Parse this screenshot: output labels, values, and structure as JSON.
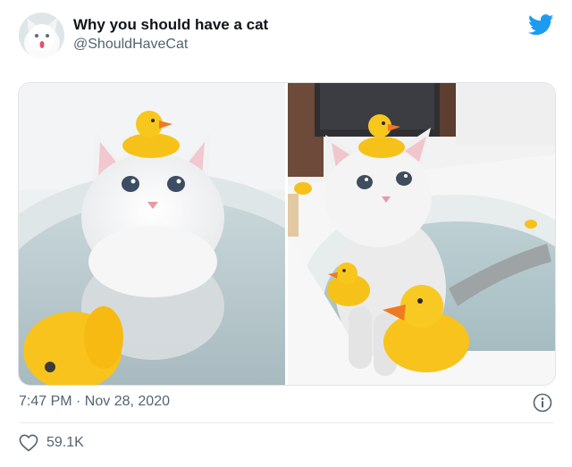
{
  "tweet": {
    "author": {
      "display_name": "Why you should have a cat",
      "handle": "@ShouldHaveCat",
      "avatar_icon": "white-cat-avatar"
    },
    "brand_icon": "twitter-bird-icon",
    "media": {
      "photo_count": 2
    },
    "timestamp": "7:47 PM · Nov 28, 2020",
    "info_icon": "info-icon",
    "likes": {
      "icon": "heart-icon",
      "count": "59.1K"
    }
  },
  "colors": {
    "twitter_blue": "#1d9bf0",
    "secondary_text": "#536471",
    "primary_text": "#0f1419",
    "divider": "#e6ecf0",
    "duck_yellow": "#f8c31c",
    "duck_beak": "#ef7a1f"
  }
}
